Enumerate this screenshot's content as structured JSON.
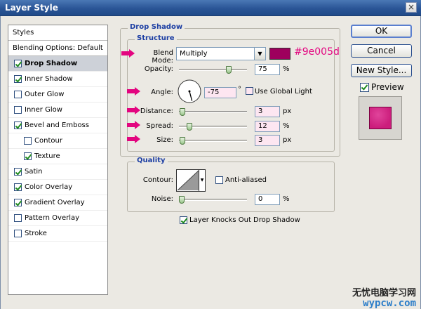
{
  "window": {
    "title": "Layer Style",
    "close_glyph": "×"
  },
  "styles_list": {
    "header": "Styles",
    "blending": "Blending Options: Default",
    "items": [
      {
        "label": "Drop Shadow",
        "checked": true,
        "selected": true,
        "indent": false
      },
      {
        "label": "Inner Shadow",
        "checked": true,
        "selected": false,
        "indent": false
      },
      {
        "label": "Outer Glow",
        "checked": false,
        "selected": false,
        "indent": false
      },
      {
        "label": "Inner Glow",
        "checked": false,
        "selected": false,
        "indent": false
      },
      {
        "label": "Bevel and Emboss",
        "checked": true,
        "selected": false,
        "indent": false
      },
      {
        "label": "Contour",
        "checked": false,
        "selected": false,
        "indent": true
      },
      {
        "label": "Texture",
        "checked": true,
        "selected": false,
        "indent": true
      },
      {
        "label": "Satin",
        "checked": true,
        "selected": false,
        "indent": false
      },
      {
        "label": "Color Overlay",
        "checked": true,
        "selected": false,
        "indent": false
      },
      {
        "label": "Gradient Overlay",
        "checked": true,
        "selected": false,
        "indent": false
      },
      {
        "label": "Pattern Overlay",
        "checked": false,
        "selected": false,
        "indent": false
      },
      {
        "label": "Stroke",
        "checked": false,
        "selected": false,
        "indent": false
      }
    ]
  },
  "drop_shadow": {
    "section_title": "Drop Shadow",
    "structure_title": "Structure",
    "blend_mode": {
      "label": "Blend Mode:",
      "value": "Multiply"
    },
    "color": {
      "hex": "#9e005d",
      "annotation": "#9e005d"
    },
    "opacity": {
      "label": "Opacity:",
      "value": "75",
      "unit": "%",
      "fraction": 0.75
    },
    "angle": {
      "label": "Angle:",
      "value": "-75",
      "unit": "°",
      "degrees": -75
    },
    "global_light": {
      "label": "Use Global Light",
      "checked": false
    },
    "distance": {
      "label": "Distance:",
      "value": "3",
      "unit": "px",
      "fraction": 0.01
    },
    "spread": {
      "label": "Spread:",
      "value": "12",
      "unit": "%",
      "fraction": 0.12
    },
    "size": {
      "label": "Size:",
      "value": "3",
      "unit": "px",
      "fraction": 0.012
    }
  },
  "quality": {
    "title": "Quality",
    "contour_label": "Contour:",
    "anti_aliased": {
      "label": "Anti-aliased",
      "checked": false
    },
    "noise": {
      "label": "Noise:",
      "value": "0",
      "unit": "%",
      "fraction": 0.0
    }
  },
  "knockout": {
    "label": "Layer Knocks Out Drop Shadow",
    "checked": true
  },
  "buttons": {
    "ok": "OK",
    "cancel": "Cancel",
    "new_style": "New Style..."
  },
  "preview": {
    "label": "Preview",
    "checked": true,
    "swatch_color": "#cc1d7c"
  },
  "watermark": {
    "line1": "无忧电脑学习网",
    "line2": "wypcw.com"
  },
  "colors": {
    "accent_arrow": "#e3047f",
    "section_title": "#1c3ea3"
  }
}
